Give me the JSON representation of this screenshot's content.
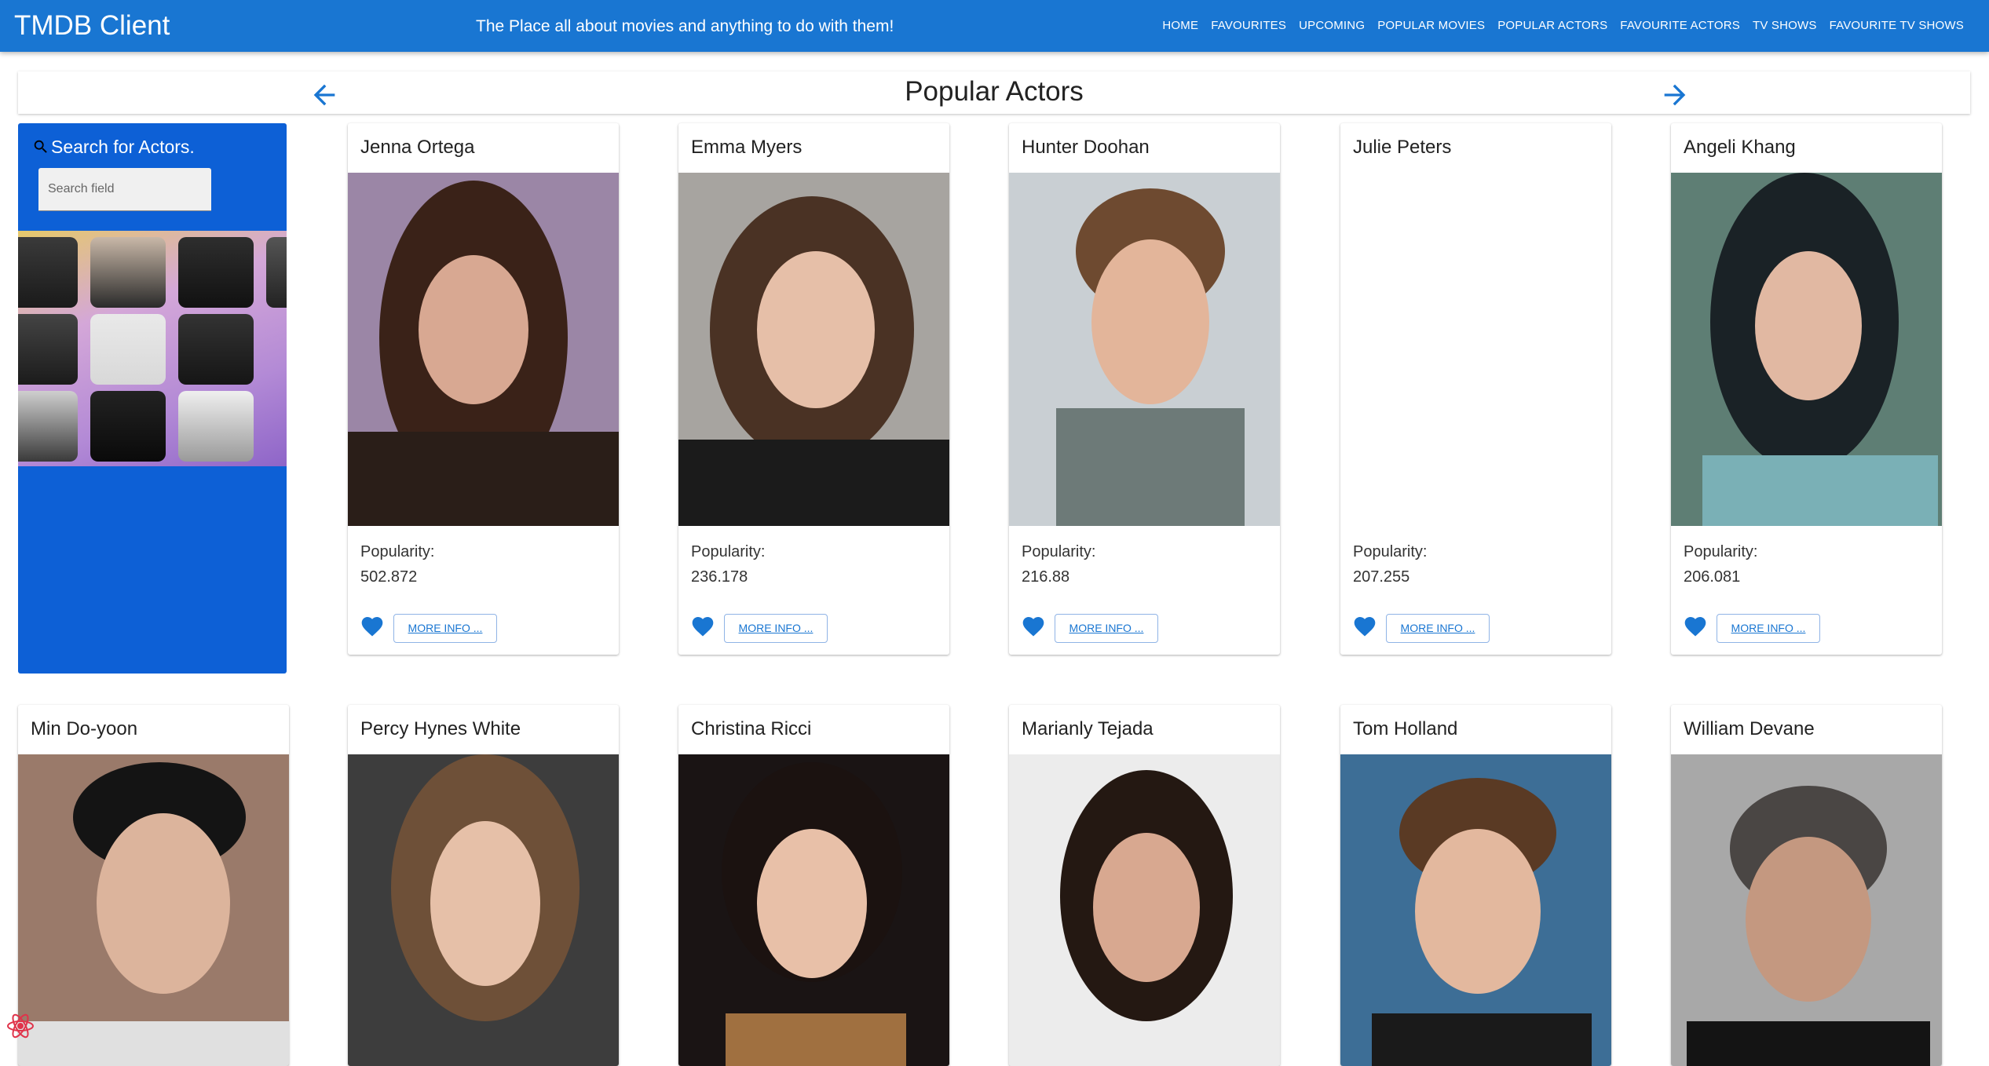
{
  "app": {
    "title": "TMDB Client",
    "tagline": "The Place all about movies and anything to do with them!",
    "accent_color": "#1976d2"
  },
  "nav": {
    "items": [
      "HOME",
      "FAVOURITES",
      "UPCOMING",
      "POPULAR MOVIES",
      "POPULAR ACTORS",
      "FAVOURITE ACTORS",
      "TV SHOWS",
      "FAVOURITE TV SHOWS"
    ]
  },
  "header": {
    "title": "Popular Actors",
    "prev_icon": "arrow-left-icon",
    "next_icon": "arrow-right-icon"
  },
  "sidebar": {
    "search_label": "Search for Actors.",
    "search_placeholder": "Search field",
    "search_icon": "search-icon",
    "background_color": "#0d60d6"
  },
  "cards": [
    {
      "name": "Jenna Ortega",
      "popularity_label": "Popularity:",
      "popularity": "502.872",
      "more_label": "MORE INFO ...",
      "has_photo": true
    },
    {
      "name": "Emma Myers",
      "popularity_label": "Popularity:",
      "popularity": "236.178",
      "more_label": "MORE INFO ...",
      "has_photo": true
    },
    {
      "name": "Hunter Doohan",
      "popularity_label": "Popularity:",
      "popularity": "216.88",
      "more_label": "MORE INFO ...",
      "has_photo": true
    },
    {
      "name": "Julie Peters",
      "popularity_label": "Popularity:",
      "popularity": "207.255",
      "more_label": "MORE INFO ...",
      "has_photo": false
    },
    {
      "name": "Angeli Khang",
      "popularity_label": "Popularity:",
      "popularity": "206.081",
      "more_label": "MORE INFO ...",
      "has_photo": true
    },
    {
      "name": "Min Do-yoon",
      "has_photo": true
    },
    {
      "name": "Percy Hynes White",
      "has_photo": true
    },
    {
      "name": "Christina Ricci",
      "has_photo": true
    },
    {
      "name": "Marianly Tejada",
      "has_photo": true
    },
    {
      "name": "Tom Holland",
      "has_photo": true
    },
    {
      "name": "William Devane",
      "has_photo": true
    }
  ]
}
